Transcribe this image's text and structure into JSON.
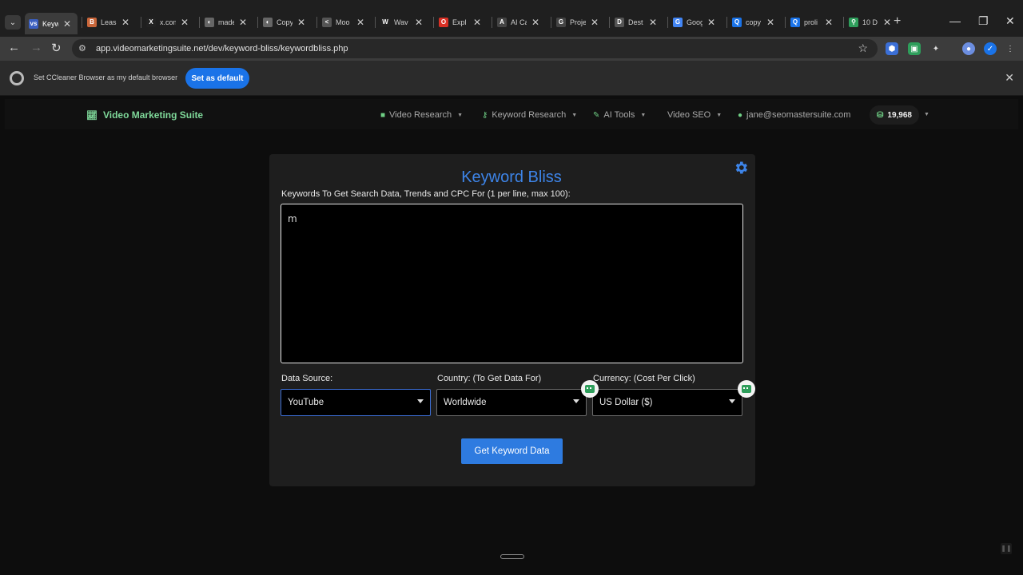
{
  "browser": {
    "tabs": [
      {
        "label": "Keyw",
        "color": "#3b5fc0",
        "glyph": "vs"
      },
      {
        "label": "Leas",
        "color": "#c9663a",
        "glyph": "B"
      },
      {
        "label": "x.com",
        "color": "#222222",
        "glyph": "X"
      },
      {
        "label": "made",
        "color": "#666666",
        "glyph": "◐"
      },
      {
        "label": "Copy",
        "color": "#666666",
        "glyph": "◐"
      },
      {
        "label": "Moo",
        "color": "#555555",
        "glyph": "<"
      },
      {
        "label": "Wav",
        "color": "#222222",
        "glyph": "W"
      },
      {
        "label": "Expl",
        "color": "#d93025",
        "glyph": "O"
      },
      {
        "label": "AI Ca",
        "color": "#444444",
        "glyph": "A"
      },
      {
        "label": "Proje",
        "color": "#444444",
        "glyph": "G"
      },
      {
        "label": "Dest",
        "color": "#555555",
        "glyph": "D"
      },
      {
        "label": "Goog",
        "color": "#4285f4",
        "glyph": "G"
      },
      {
        "label": "copy",
        "color": "#1a73e8",
        "glyph": "Q"
      },
      {
        "label": "proli",
        "color": "#1a73e8",
        "glyph": "Q"
      },
      {
        "label": "10 D",
        "color": "#2e9e5b",
        "glyph": "⚲"
      }
    ],
    "url": "app.videomarketingsuite.net/dev/keyword-bliss/keywordbliss.php",
    "infobar_message": "Set CCleaner Browser as my default browser",
    "infobar_button": "Set as default"
  },
  "app": {
    "brand": "Video Marketing Suite",
    "nav": {
      "video_research": "Video Research",
      "keyword_research": "Keyword Research",
      "ai_tools": "AI Tools",
      "video_seo": "Video SEO",
      "account": "jane@seomastersuite.com",
      "credits": "19,968"
    }
  },
  "main": {
    "title": "Keyword Bliss",
    "keywords_label": "Keywords To Get Search Data, Trends and CPC For (1 per line, max 100):",
    "keywords_value": "m",
    "data_source_label": "Data Source:",
    "data_source_value": "YouTube",
    "country_label": "Country: (To Get Data For)",
    "country_value": "Worldwide",
    "currency_label": "Currency: (Cost Per Click)",
    "currency_value": "US Dollar ($)",
    "submit_label": "Get Keyword Data"
  }
}
